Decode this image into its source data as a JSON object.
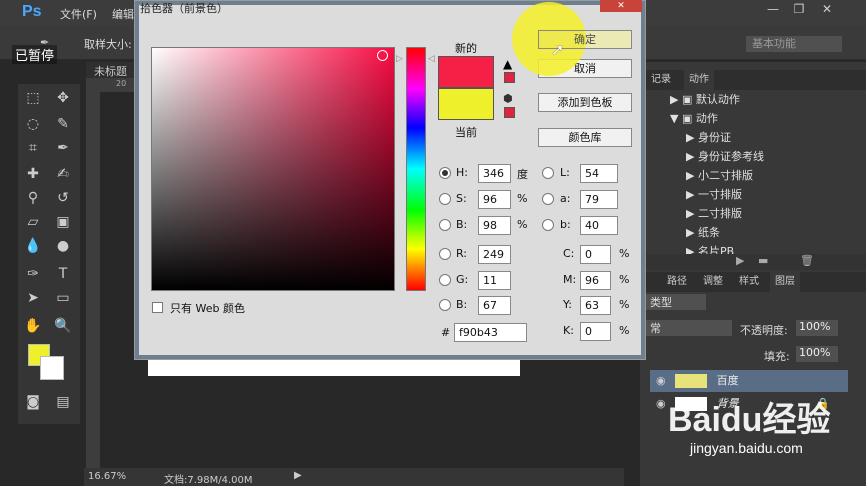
{
  "app": {
    "logo": "Ps",
    "paused_overlay": "已暂停"
  },
  "menu": {
    "file": "文件(F)",
    "edit": "编辑"
  },
  "options": {
    "sample_size": "取样大小:",
    "workspace": "基本功能"
  },
  "document": {
    "tab": "未标题",
    "ruler_h": "20",
    "zoom": "16.67%",
    "doc_info": "文档:7.98M/4.00M"
  },
  "dialog": {
    "title": "拾色器（前景色）",
    "new_label": "新的",
    "current_label": "当前",
    "new_color": "#f61f45",
    "current_color": "#eef02c",
    "buttons": {
      "ok": "确定",
      "cancel": "取消",
      "add_swatch": "添加到色板",
      "libraries": "颜色库"
    },
    "web_only": "只有 Web 颜色",
    "hsb": {
      "h_label": "H:",
      "h": "346",
      "h_unit": "度",
      "s_label": "S:",
      "s": "96",
      "s_unit": "%",
      "b_label": "B:",
      "b": "98",
      "b_unit": "%"
    },
    "rgb": {
      "r_label": "R:",
      "r": "249",
      "g_label": "G:",
      "g": "11",
      "b_label": "B:",
      "b": "67"
    },
    "lab": {
      "l_label": "L:",
      "l": "54",
      "a_label": "a:",
      "a": "79",
      "b_label": "b:",
      "b": "40"
    },
    "cmyk": {
      "c_label": "C:",
      "c": "0",
      "c_unit": "%",
      "m_label": "M:",
      "m": "96",
      "m_unit": "%",
      "y_label": "Y:",
      "y": "63",
      "y_unit": "%",
      "k_label": "K:",
      "k": "0",
      "k_unit": "%"
    },
    "hex_label": "#",
    "hex": "f90b43"
  },
  "panels": {
    "history_tab": "记录",
    "actions_tab": "动作",
    "actions": [
      "默认动作",
      "动作",
      "身份证",
      "身份证参考线",
      "小二寸排版",
      "一寸排版",
      "二寸排版",
      "纸条",
      "名片PB"
    ],
    "layer_tabs": [
      "路径",
      "调整",
      "样式",
      "图层"
    ],
    "kind": "类型",
    "blend": "常",
    "opacity_label": "不透明度:",
    "opacity": "100%",
    "fill_label": "填充:",
    "fill": "100%",
    "layers": [
      "百度",
      "背景"
    ]
  },
  "watermark": {
    "brand": "Baidu经验",
    "url": "jingyan.baidu.com"
  },
  "colors": {
    "foreground": "#eef02c",
    "background": "#ffffff"
  }
}
